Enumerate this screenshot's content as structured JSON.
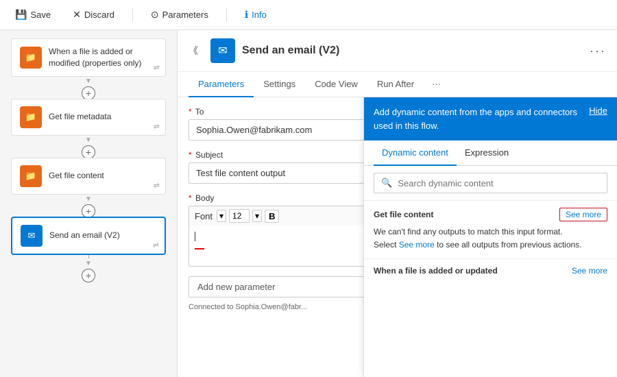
{
  "toolbar": {
    "save_label": "Save",
    "discard_label": "Discard",
    "parameters_label": "Parameters",
    "info_label": "Info"
  },
  "left_panel": {
    "steps": [
      {
        "id": "step1",
        "title": "When a file is added or modified (properties only)",
        "icon": "📁",
        "active": false
      },
      {
        "id": "step2",
        "title": "Get file metadata",
        "icon": "📁",
        "active": false
      },
      {
        "id": "step3",
        "title": "Get file content",
        "icon": "📁",
        "active": false
      },
      {
        "id": "step4",
        "title": "Send an email (V2)",
        "icon": "✉",
        "active": true
      }
    ]
  },
  "right_panel": {
    "header": {
      "title": "Send an email (V2)",
      "icon": "✉"
    },
    "tabs": [
      {
        "label": "Parameters",
        "active": true
      },
      {
        "label": "Settings",
        "active": false
      },
      {
        "label": "Code View",
        "active": false
      },
      {
        "label": "Run After",
        "active": false
      }
    ],
    "fields": {
      "to_label": "To",
      "to_value": "Sophia.Owen@fabrikam.com",
      "subject_label": "Subject",
      "subject_value": "Test file content output",
      "body_label": "Body",
      "body_font_label": "Font",
      "body_font_size": "12"
    },
    "add_param_label": "Add new parameter",
    "connected_text": "Connected to  Sophia.Owen@fabr..."
  },
  "dynamic_panel": {
    "header_text": "Add dynamic content from the apps and connectors used in this flow.",
    "hide_label": "Hide",
    "tabs": [
      {
        "label": "Dynamic content",
        "active": true
      },
      {
        "label": "Expression",
        "active": false
      }
    ],
    "search_placeholder": "Search dynamic content",
    "section1": {
      "title": "Get file content",
      "see_more_label": "See more",
      "cant_find_text": "We can't find any outputs to match this input format.\nSelect See more to see all outputs from previous actions."
    },
    "section2": {
      "title": "When a file is added or updated",
      "see_more_label": "See more"
    }
  }
}
